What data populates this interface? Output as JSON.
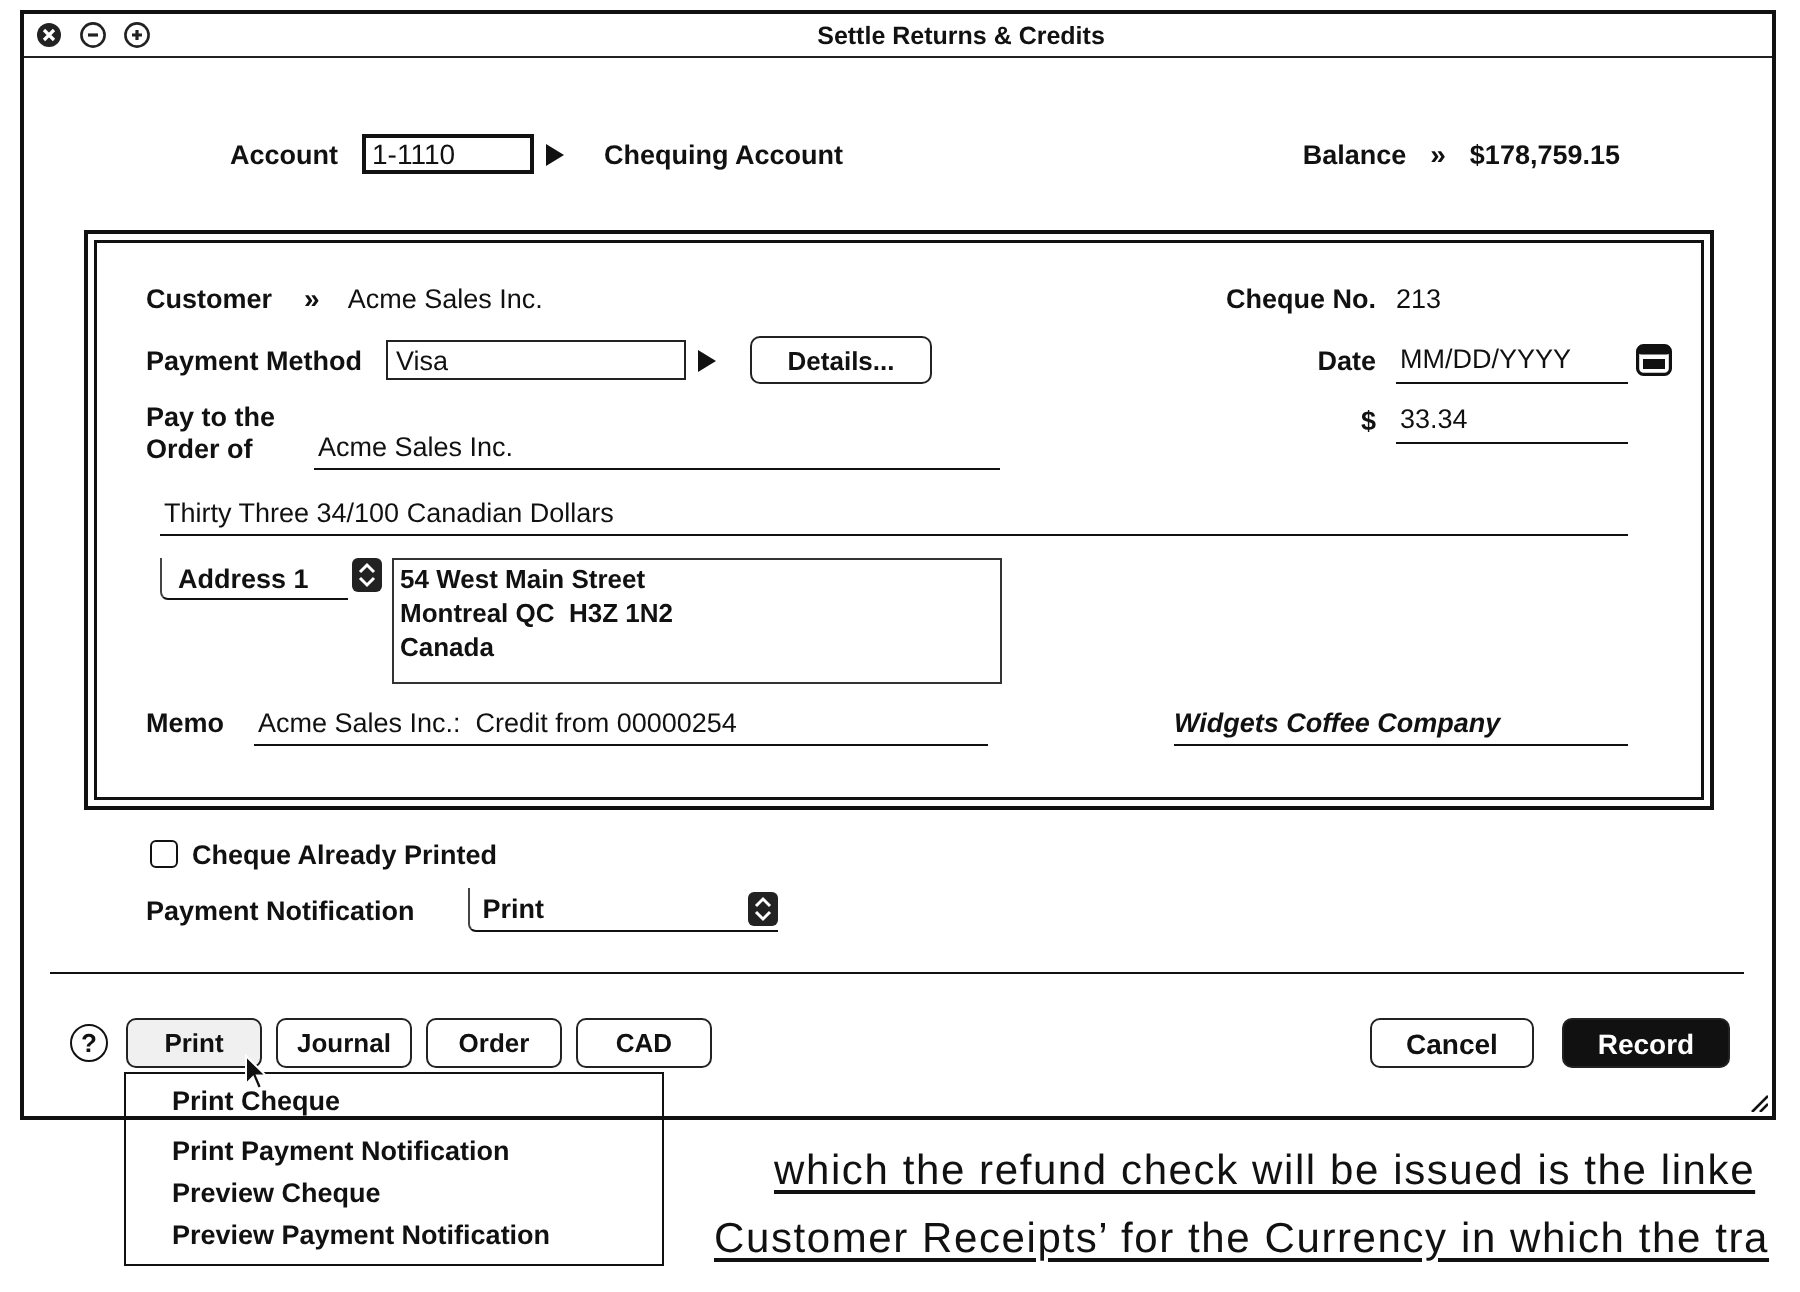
{
  "window": {
    "title": "Settle Returns & Credits"
  },
  "account": {
    "label": "Account",
    "value": "1-1110",
    "name": "Chequing Account"
  },
  "balance": {
    "label": "Balance",
    "separator": "»",
    "value": "$178,759.15"
  },
  "cheque": {
    "customer": {
      "label": "Customer",
      "separator": "»",
      "value": "Acme Sales Inc."
    },
    "cheque_no": {
      "label": "Cheque No.",
      "value": "213"
    },
    "payment_method": {
      "label": "Payment Method",
      "value": "Visa",
      "button": "Details..."
    },
    "date": {
      "label": "Date",
      "placeholder": "MM/DD/YYYY"
    },
    "pay_to": {
      "label": "Pay to the\nOrder of",
      "value": "Acme Sales Inc."
    },
    "amount": {
      "label": "$",
      "value": "33.34"
    },
    "amount_words": "Thirty Three 34/100 Canadian Dollars",
    "address": {
      "selector": "Address 1",
      "lines": [
        "54 West Main Street",
        "Montreal QC  H3Z 1N2",
        "Canada"
      ]
    },
    "memo": {
      "label": "Memo",
      "value": "Acme Sales Inc.:  Credit from 00000254"
    },
    "company": "Widgets Coffee Company"
  },
  "cheque_already_printed": {
    "label": "Cheque Already Printed",
    "checked": false
  },
  "payment_notification": {
    "label": "Payment Notification",
    "value": "Print"
  },
  "help_button": "?",
  "action_buttons": [
    {
      "label": "Print",
      "expanded": true,
      "menu": [
        "Print Cheque",
        "Print Payment Notification",
        "Preview Cheque",
        "Preview Payment Notification"
      ]
    },
    {
      "label": "Journal",
      "expanded": false
    },
    {
      "label": "Order",
      "expanded": false
    },
    {
      "label": "CAD",
      "expanded": false
    }
  ],
  "dialog_buttons": [
    {
      "label": "Cancel",
      "default": false
    },
    {
      "label": "Record",
      "default": true
    }
  ],
  "background_document": {
    "lines": [
      "which the refund check will be issued is the linke",
      "Customer Receipts’ for the Currency in which the tra"
    ]
  }
}
